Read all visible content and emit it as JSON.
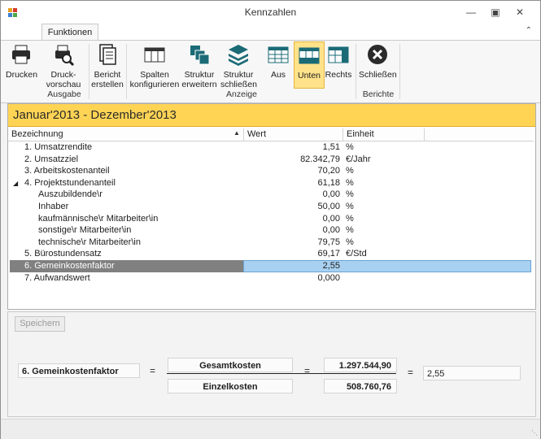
{
  "window": {
    "title": "Kennzahlen"
  },
  "ribbon": {
    "tab": "Funktionen",
    "buttons": {
      "drucken": "Drucken",
      "druckvorschau": "Druck-\nvorschau",
      "bericht": "Bericht\nerstellen",
      "spalten": "Spalten\nkonfigurieren",
      "struktur_erweitern": "Struktur\nerweitern",
      "struktur_schliessen": "Struktur\nschließen",
      "aus": "Aus",
      "unten": "Unten",
      "rechts": "Rechts",
      "schliessen": "Schließen"
    },
    "groups": {
      "ausgabe": "Ausgabe",
      "anzeige": "Anzeige",
      "berichte": "Berichte"
    }
  },
  "period": "Januar'2013 - Dezember'2013",
  "grid": {
    "columns": [
      "Bezeichnung",
      "Wert",
      "Einheit"
    ],
    "rows": [
      {
        "name": "1. Umsatzrendite",
        "value": "1,51",
        "unit": "%"
      },
      {
        "name": "2. Umsatzziel",
        "value": "82.342,79",
        "unit": "€/Jahr"
      },
      {
        "name": "3. Arbeitskostenanteil",
        "value": "70,20",
        "unit": "%"
      },
      {
        "name": "4. Projektstundenanteil",
        "value": "61,18",
        "unit": "%"
      },
      {
        "name": "Auszubildende\\r",
        "value": "0,00",
        "unit": "%"
      },
      {
        "name": "Inhaber",
        "value": "50,00",
        "unit": "%"
      },
      {
        "name": "kaufmännische\\r Mitarbeiter\\in",
        "value": "0,00",
        "unit": "%"
      },
      {
        "name": "sonstige\\r Mitarbeiter\\in",
        "value": "0,00",
        "unit": "%"
      },
      {
        "name": "technische\\r Mitarbeiter\\in",
        "value": "79,75",
        "unit": "%"
      },
      {
        "name": "5. Bürostundensatz",
        "value": "69,17",
        "unit": "€/Std"
      },
      {
        "name": "6. Gemeinkostenfaktor",
        "value": "2,55",
        "unit": ""
      },
      {
        "name": "7. Aufwandswert",
        "value": "0,000",
        "unit": ""
      }
    ]
  },
  "detail": {
    "save_label": "Speichern",
    "formula_name": "6. Gemeinkostenfaktor",
    "eq": "=",
    "numerator_label": "Gesamtkosten",
    "denominator_label": "Einzelkosten",
    "numerator_value": "1.297.544,90",
    "denominator_value": "508.760,76",
    "result": "2,55"
  },
  "colors": {
    "period_bar": "#ffd455",
    "selected_value": "#a8d0f0",
    "active_button": "#ffe28a"
  }
}
